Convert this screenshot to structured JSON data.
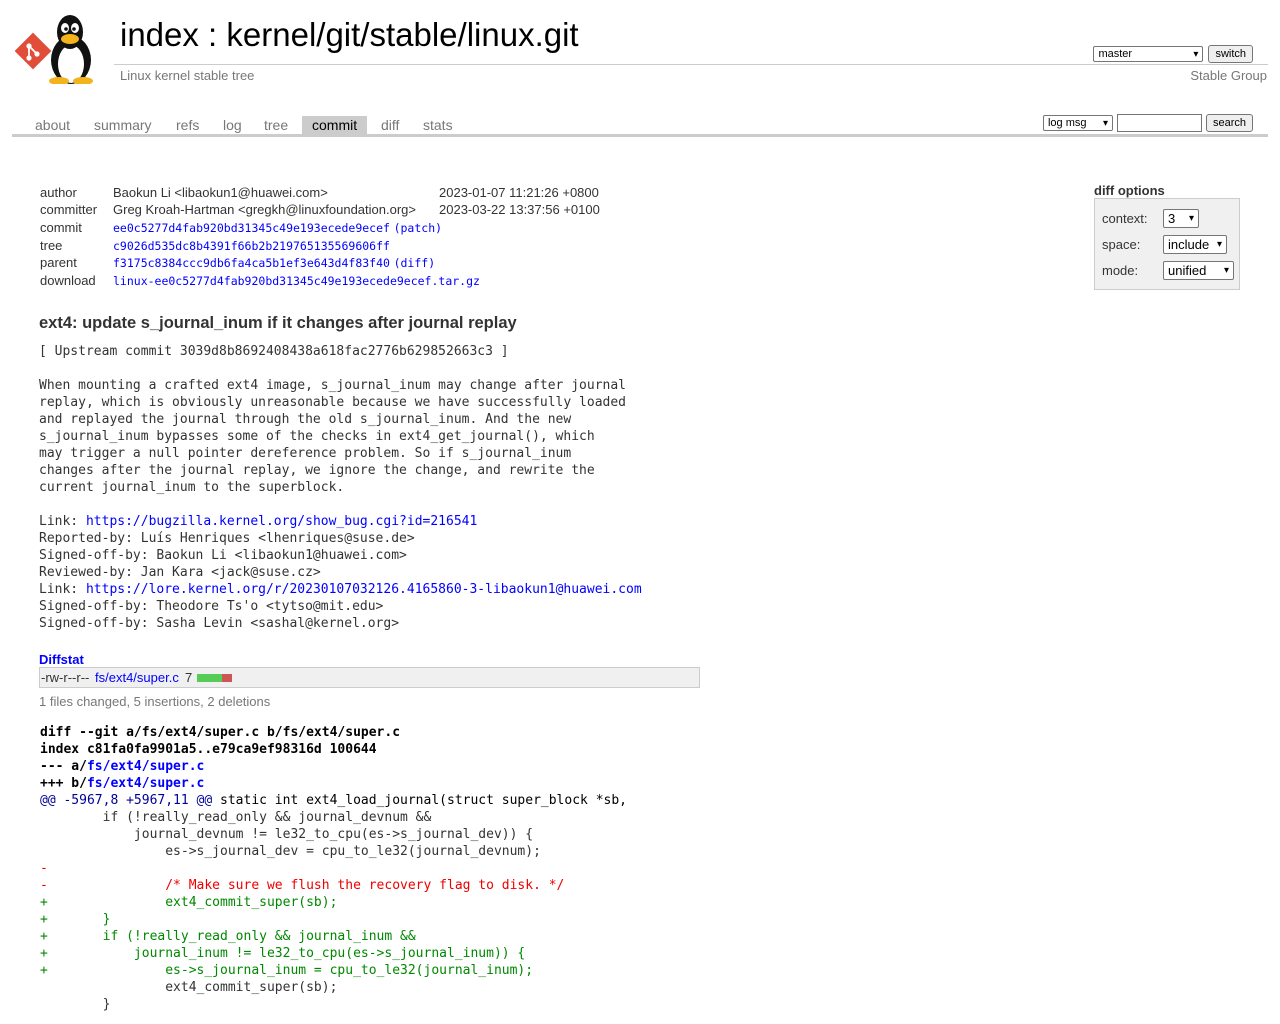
{
  "header": {
    "title_index": "index",
    "title_sep": " : ",
    "title_repo": "kernel/git/stable/linux.git",
    "description": "Linux kernel stable tree",
    "owner": "Stable Group",
    "branch_select": "master",
    "switch_button": "switch"
  },
  "tabs": [
    {
      "label": "about"
    },
    {
      "label": "summary"
    },
    {
      "label": "refs"
    },
    {
      "label": "log"
    },
    {
      "label": "tree"
    },
    {
      "label": "commit",
      "active": true
    },
    {
      "label": "diff"
    },
    {
      "label": "stats"
    }
  ],
  "search": {
    "mode": "log msg",
    "value": "",
    "button": "search"
  },
  "diff_options": {
    "title": "diff options",
    "context_label": "context:",
    "context_value": "3",
    "space_label": "space:",
    "space_value": "include",
    "mode_label": "mode:",
    "mode_value": "unified"
  },
  "commit_info": {
    "author_label": "author",
    "author": "Baokun Li <libaokun1@huawei.com>",
    "author_date": "2023-01-07 11:21:26 +0800",
    "committer_label": "committer",
    "committer": "Greg Kroah-Hartman <gregkh@linuxfoundation.org>",
    "committer_date": "2023-03-22 13:37:56 +0100",
    "commit_label": "commit",
    "commit_hash": "ee0c5277d4fab920bd31345c49e193ecede9ecef",
    "patch_link": "(patch)",
    "tree_label": "tree",
    "tree_hash": "c9026d535dc8b4391f66b2b219765135569606ff",
    "parent_label": "parent",
    "parent_hash": "f3175c8384ccc9db6fa4ca5b1ef3e643d4f83f40",
    "diff_link": "(diff)",
    "download_label": "download",
    "download_link": "linux-ee0c5277d4fab920bd31345c49e193ecede9ecef.tar.gz"
  },
  "subject": "ext4: update s_journal_inum if it changes after journal replay",
  "message": {
    "upstream": "[ Upstream commit 3039d8b8692408438a618fac2776b629852663c3 ]",
    "body": "When mounting a crafted ext4 image, s_journal_inum may change after journal\nreplay, which is obviously unreasonable because we have successfully loaded\nand replayed the journal through the old s_journal_inum. And the new\ns_journal_inum bypasses some of the checks in ext4_get_journal(), which\nmay trigger a null pointer dereference problem. So if s_journal_inum\nchanges after the journal replay, we ignore the change, and rewrite the\ncurrent journal_inum to the superblock.",
    "link1_label": "Link: ",
    "link1": "https://bugzilla.kernel.org/show_bug.cgi?id=216541",
    "reported_by": "Reported-by: Luís Henriques <lhenriques@suse.de>",
    "signed_off_1": "Signed-off-by: Baokun Li <libaokun1@huawei.com>",
    "reviewed_by": "Reviewed-by: Jan Kara <jack@suse.cz>",
    "link2_label": "Link: ",
    "link2": "https://lore.kernel.org/r/20230107032126.4165860-3-libaokun1@huawei.com",
    "signed_off_2": "Signed-off-by: Theodore Ts'o <tytso@mit.edu>",
    "signed_off_3": "Signed-off-by: Sasha Levin <sashal@kernel.org>"
  },
  "diffstat": {
    "title": "Diffstat",
    "mode": "-rw-r--r--",
    "file": "fs/ext4/super.c",
    "changes": "7",
    "insertions": 5,
    "deletions": 2,
    "summary": "1 files changed, 5 insertions, 2 deletions"
  },
  "diff": {
    "git_line": "diff --git a/fs/ext4/super.c b/fs/ext4/super.c",
    "index_line": "index c81fa0fa9901a5..e79ca9ef98316d 100644",
    "old_prefix": "--- a/",
    "new_prefix": "+++ b/",
    "file": "fs/ext4/super.c",
    "hunk_range": "@@ -5967,8 +5967,11 @@",
    "hunk_context": " static int ext4_load_journal(struct super_block *sb,",
    "lines": [
      {
        "type": "ctx",
        "text": "        if (!really_read_only && journal_devnum &&"
      },
      {
        "type": "ctx",
        "text": "            journal_devnum != le32_to_cpu(es->s_journal_dev)) {"
      },
      {
        "type": "ctx",
        "text": "                es->s_journal_dev = cpu_to_le32(journal_devnum);"
      },
      {
        "type": "del",
        "text": "-"
      },
      {
        "type": "del",
        "text": "-               /* Make sure we flush the recovery flag to disk. */"
      },
      {
        "type": "add",
        "text": "+               ext4_commit_super(sb);"
      },
      {
        "type": "add",
        "text": "+       }"
      },
      {
        "type": "add",
        "text": "+       if (!really_read_only && journal_inum &&"
      },
      {
        "type": "add",
        "text": "+           journal_inum != le32_to_cpu(es->s_journal_inum)) {"
      },
      {
        "type": "add",
        "text": "+               es->s_journal_inum = cpu_to_le32(journal_inum);"
      },
      {
        "type": "ctx",
        "text": "                ext4_commit_super(sb);"
      },
      {
        "type": "ctx",
        "text": "        }"
      }
    ]
  }
}
